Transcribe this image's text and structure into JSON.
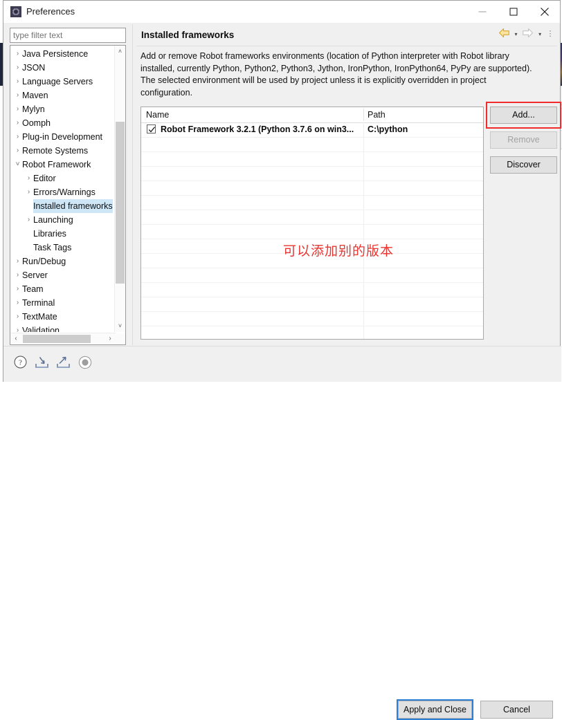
{
  "window": {
    "title": "Preferences",
    "icon": "preferences-gear-icon",
    "controls": [
      {
        "name": "minimize",
        "glyph": "minimize-icon"
      },
      {
        "name": "maximize",
        "glyph": "maximize-icon"
      },
      {
        "name": "close",
        "glyph": "close-icon"
      }
    ]
  },
  "filter": {
    "value": "",
    "placeholder": "type filter text"
  },
  "tree": {
    "items": [
      {
        "label": "Java Persistence",
        "indent": 0,
        "twisty": "collapsed",
        "selected": false
      },
      {
        "label": "JSON",
        "indent": 0,
        "twisty": "collapsed",
        "selected": false
      },
      {
        "label": "Language Servers",
        "indent": 0,
        "twisty": "collapsed",
        "selected": false
      },
      {
        "label": "Maven",
        "indent": 0,
        "twisty": "collapsed",
        "selected": false
      },
      {
        "label": "Mylyn",
        "indent": 0,
        "twisty": "collapsed",
        "selected": false
      },
      {
        "label": "Oomph",
        "indent": 0,
        "twisty": "collapsed",
        "selected": false
      },
      {
        "label": "Plug-in Development",
        "indent": 0,
        "twisty": "collapsed",
        "selected": false
      },
      {
        "label": "Remote Systems",
        "indent": 0,
        "twisty": "collapsed",
        "selected": false
      },
      {
        "label": "Robot Framework",
        "indent": 0,
        "twisty": "expanded",
        "selected": false
      },
      {
        "label": "Editor",
        "indent": 1,
        "twisty": "collapsed",
        "selected": false
      },
      {
        "label": "Errors/Warnings",
        "indent": 1,
        "twisty": "collapsed",
        "selected": false
      },
      {
        "label": "Installed frameworks",
        "indent": 1,
        "twisty": "none",
        "selected": true
      },
      {
        "label": "Launching",
        "indent": 1,
        "twisty": "collapsed",
        "selected": false
      },
      {
        "label": "Libraries",
        "indent": 1,
        "twisty": "none",
        "selected": false
      },
      {
        "label": "Task Tags",
        "indent": 1,
        "twisty": "none",
        "selected": false
      },
      {
        "label": "Run/Debug",
        "indent": 0,
        "twisty": "collapsed",
        "selected": false
      },
      {
        "label": "Server",
        "indent": 0,
        "twisty": "collapsed",
        "selected": false
      },
      {
        "label": "Team",
        "indent": 0,
        "twisty": "collapsed",
        "selected": false
      },
      {
        "label": "Terminal",
        "indent": 0,
        "twisty": "collapsed",
        "selected": false
      },
      {
        "label": "TextMate",
        "indent": 0,
        "twisty": "collapsed",
        "selected": false
      },
      {
        "label": "Validation",
        "indent": 0,
        "twisty": "collapsed",
        "selected": false
      }
    ],
    "selection_color": "#cfe6f7",
    "scroll_up_glyph": "˄",
    "scroll_down_glyph": "˅",
    "scroll_left_glyph": "‹",
    "scroll_right_glyph": "›"
  },
  "page": {
    "title": "Installed frameworks",
    "description": "Add or remove Robot frameworks environments (location of Python interpreter with Robot library installed, currently Python, Python2, Python3, Jython, IronPython, IronPython64, PyPy are supported). The selected environment will be used by project unless it is explicitly overridden in project configuration.",
    "nav": {
      "back": "back-arrow-icon",
      "back_caret": "▾",
      "forward": "forward-arrow-icon",
      "forward_caret": "▾",
      "menu": "⋮",
      "back_color": "#f5c242",
      "forward_color": "#c9c9c9"
    }
  },
  "table": {
    "columns": [
      "Name",
      "Path"
    ],
    "rows": [
      {
        "checked": true,
        "name": "Robot Framework 3.2.1 (Python 3.7.6 on win3...",
        "path": "C:\\python"
      }
    ],
    "annotation": "可以添加别的版本",
    "annotation_color": "#e8342f"
  },
  "side_buttons": [
    {
      "label": "Add...",
      "enabled": true,
      "highlighted": true
    },
    {
      "label": "Remove",
      "enabled": false,
      "highlighted": false
    },
    {
      "label": "Discover",
      "enabled": true,
      "highlighted": false
    }
  ],
  "footer": {
    "icons": [
      {
        "name": "help-icon",
        "title": "Help"
      },
      {
        "name": "import-icon",
        "title": "Import"
      },
      {
        "name": "export-icon",
        "title": "Export"
      },
      {
        "name": "restore-defaults-icon",
        "title": "Restore Defaults"
      }
    ],
    "apply_label": "Apply and Close",
    "cancel_label": "Cancel",
    "focus_color": "#2b7fd4"
  }
}
